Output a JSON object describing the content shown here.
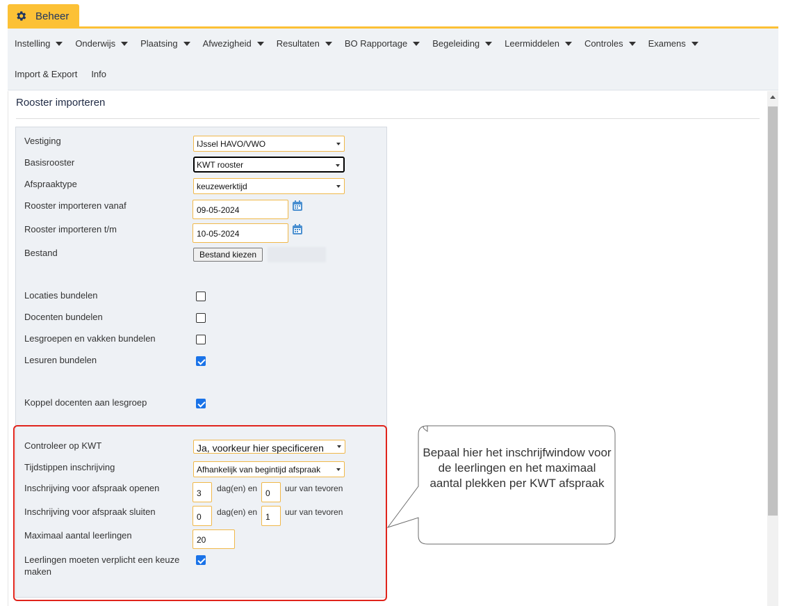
{
  "tab": {
    "label": "Beheer",
    "icon": "gear-icon"
  },
  "menu": {
    "row1": [
      {
        "label": "Instelling",
        "dropdown": true
      },
      {
        "label": "Onderwijs",
        "dropdown": true
      },
      {
        "label": "Plaatsing",
        "dropdown": true
      },
      {
        "label": "Afwezigheid",
        "dropdown": true
      },
      {
        "label": "Resultaten",
        "dropdown": true
      },
      {
        "label": "BO Rapportage",
        "dropdown": true
      },
      {
        "label": "Begeleiding",
        "dropdown": true
      },
      {
        "label": "Leermiddelen",
        "dropdown": true
      },
      {
        "label": "Controles",
        "dropdown": true
      },
      {
        "label": "Examens",
        "dropdown": true
      }
    ],
    "row2": [
      {
        "label": "Import & Export"
      },
      {
        "label": "Info"
      }
    ]
  },
  "page": {
    "title": "Rooster importeren"
  },
  "form": {
    "vestiging": {
      "label": "Vestiging",
      "value": "IJssel HAVO/VWO"
    },
    "basisrooster": {
      "label": "Basisrooster",
      "value": "KWT rooster"
    },
    "afspraaktype": {
      "label": "Afspraaktype",
      "value": "keuzewerktijd"
    },
    "vanaf": {
      "label": "Rooster importeren vanaf",
      "value": "09-05-2024"
    },
    "tm": {
      "label": "Rooster importeren t/m",
      "value": "10-05-2024"
    },
    "bestand": {
      "label": "Bestand",
      "button": "Bestand kiezen"
    },
    "locaties": {
      "label": "Locaties bundelen",
      "checked": false
    },
    "docenten": {
      "label": "Docenten bundelen",
      "checked": false
    },
    "lesgroepen": {
      "label": "Lesgroepen en vakken bundelen",
      "checked": false
    },
    "lesuren": {
      "label": "Lesuren bundelen",
      "checked": true
    },
    "koppel": {
      "label": "Koppel docenten aan lesgroep",
      "checked": true
    },
    "controleer": {
      "label": "Controleer op KWT",
      "value": "Ja, voorkeur hier specificeren"
    },
    "tijdstippen": {
      "label": "Tijdstippen inschrijving",
      "value": "Afhankelijk van begintijd afspraak"
    },
    "openen": {
      "label": "Inschrijving voor afspraak openen",
      "days": "3",
      "hours": "0"
    },
    "sluiten": {
      "label": "Inschrijving voor afspraak sluiten",
      "days": "0",
      "hours": "1"
    },
    "days_suffix": "dag(en) en",
    "hours_suffix": "uur van tevoren",
    "maximaal": {
      "label": "Maximaal aantal leerlingen",
      "value": "20"
    },
    "verplicht": {
      "label": "Leerlingen moeten verplicht een keuze maken",
      "checked": true
    }
  },
  "annotation": {
    "text": "Bepaal hier het inschrijfwindow voor de leerlingen en het maximaal aantal plekken per KWT afspraak",
    "color": "#e0241c"
  },
  "colors": {
    "accent": "#fcc136",
    "checkbox": "#1a73e8",
    "menubar": "#eff2f5"
  }
}
